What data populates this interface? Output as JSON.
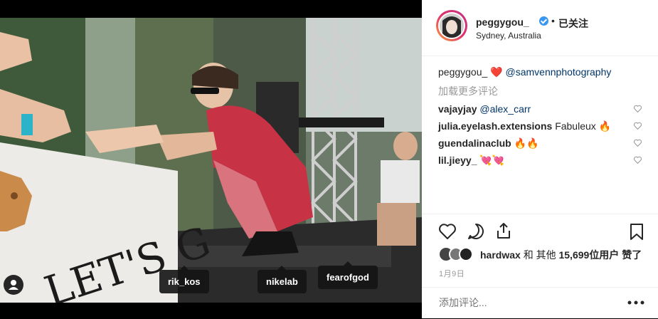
{
  "post": {
    "username": "peggygou_",
    "follow_label": "已关注",
    "separator": "•",
    "location": "Sydney, Australia"
  },
  "caption": {
    "username": "peggygou_",
    "text": "❤️",
    "mention": "@samvennphotography"
  },
  "load_more": "加载更多评论",
  "comments": [
    {
      "username": "vajayjay",
      "text": "@alex_carr",
      "is_mention": true
    },
    {
      "username": "julia.eyelash.extensions",
      "text": "Fabuleux 🔥",
      "is_mention": false
    },
    {
      "username": "guendalinaclub",
      "text": "🔥🔥",
      "is_mention": false
    },
    {
      "username": "lil.jieyy_",
      "text": "💘💘",
      "is_mention": false
    }
  ],
  "likes": {
    "first_user": "hardwax",
    "connector": "和 其他",
    "count": "15,699",
    "suffix": "位用户 赞了"
  },
  "date": "1月9日",
  "add_comment_placeholder": "添加评论...",
  "photo_tags": [
    "rik_kos",
    "nikelab",
    "fearofgod"
  ],
  "banner_text": "LET'S G",
  "colors": {
    "link": "#003569",
    "verified": "#3897f0",
    "muted": "#999999"
  },
  "icons": [
    "heart-icon",
    "comment-icon",
    "share-icon",
    "bookmark-icon",
    "user-tag-icon",
    "more-icon",
    "verified-badge-icon"
  ]
}
